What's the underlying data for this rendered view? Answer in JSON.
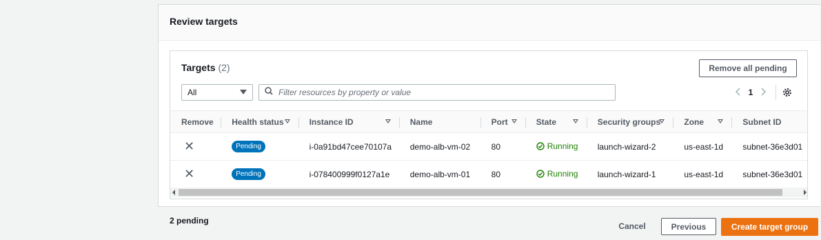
{
  "panel": {
    "title": "Review targets"
  },
  "targets": {
    "title": "Targets",
    "count": "(2)",
    "remove_all_label": "Remove all pending",
    "filter_select_value": "All",
    "search_placeholder": "Filter resources by property or value",
    "current_page": "1"
  },
  "table": {
    "columns": [
      "Remove",
      "Health status",
      "Instance ID",
      "Name",
      "Port",
      "State",
      "Security groups",
      "Zone",
      "Subnet ID"
    ],
    "rows": [
      {
        "health": "Pending",
        "instance_id": "i-0a91bd47cee70107a",
        "name": "demo-alb-vm-02",
        "port": "80",
        "state": "Running",
        "security_group": "launch-wizard-2",
        "zone": "us-east-1d",
        "subnet": "subnet-36e3d01"
      },
      {
        "health": "Pending",
        "instance_id": "i-078400999f0127a1e",
        "name": "demo-alb-vm-01",
        "port": "80",
        "state": "Running",
        "security_group": "launch-wizard-1",
        "zone": "us-east-1d",
        "subnet": "subnet-36e3d01"
      }
    ]
  },
  "footer": {
    "pending_text": "2 pending",
    "cancel_label": "Cancel",
    "previous_label": "Previous",
    "create_label": "Create target group"
  },
  "colors": {
    "primary": "#ec7211",
    "badge": "#0073bb",
    "running": "#1d8102"
  },
  "icons": [
    "search-icon",
    "chevron-left-icon",
    "chevron-right-icon",
    "gear-icon",
    "close-icon",
    "check-circle-icon",
    "caret-down-icon"
  ]
}
